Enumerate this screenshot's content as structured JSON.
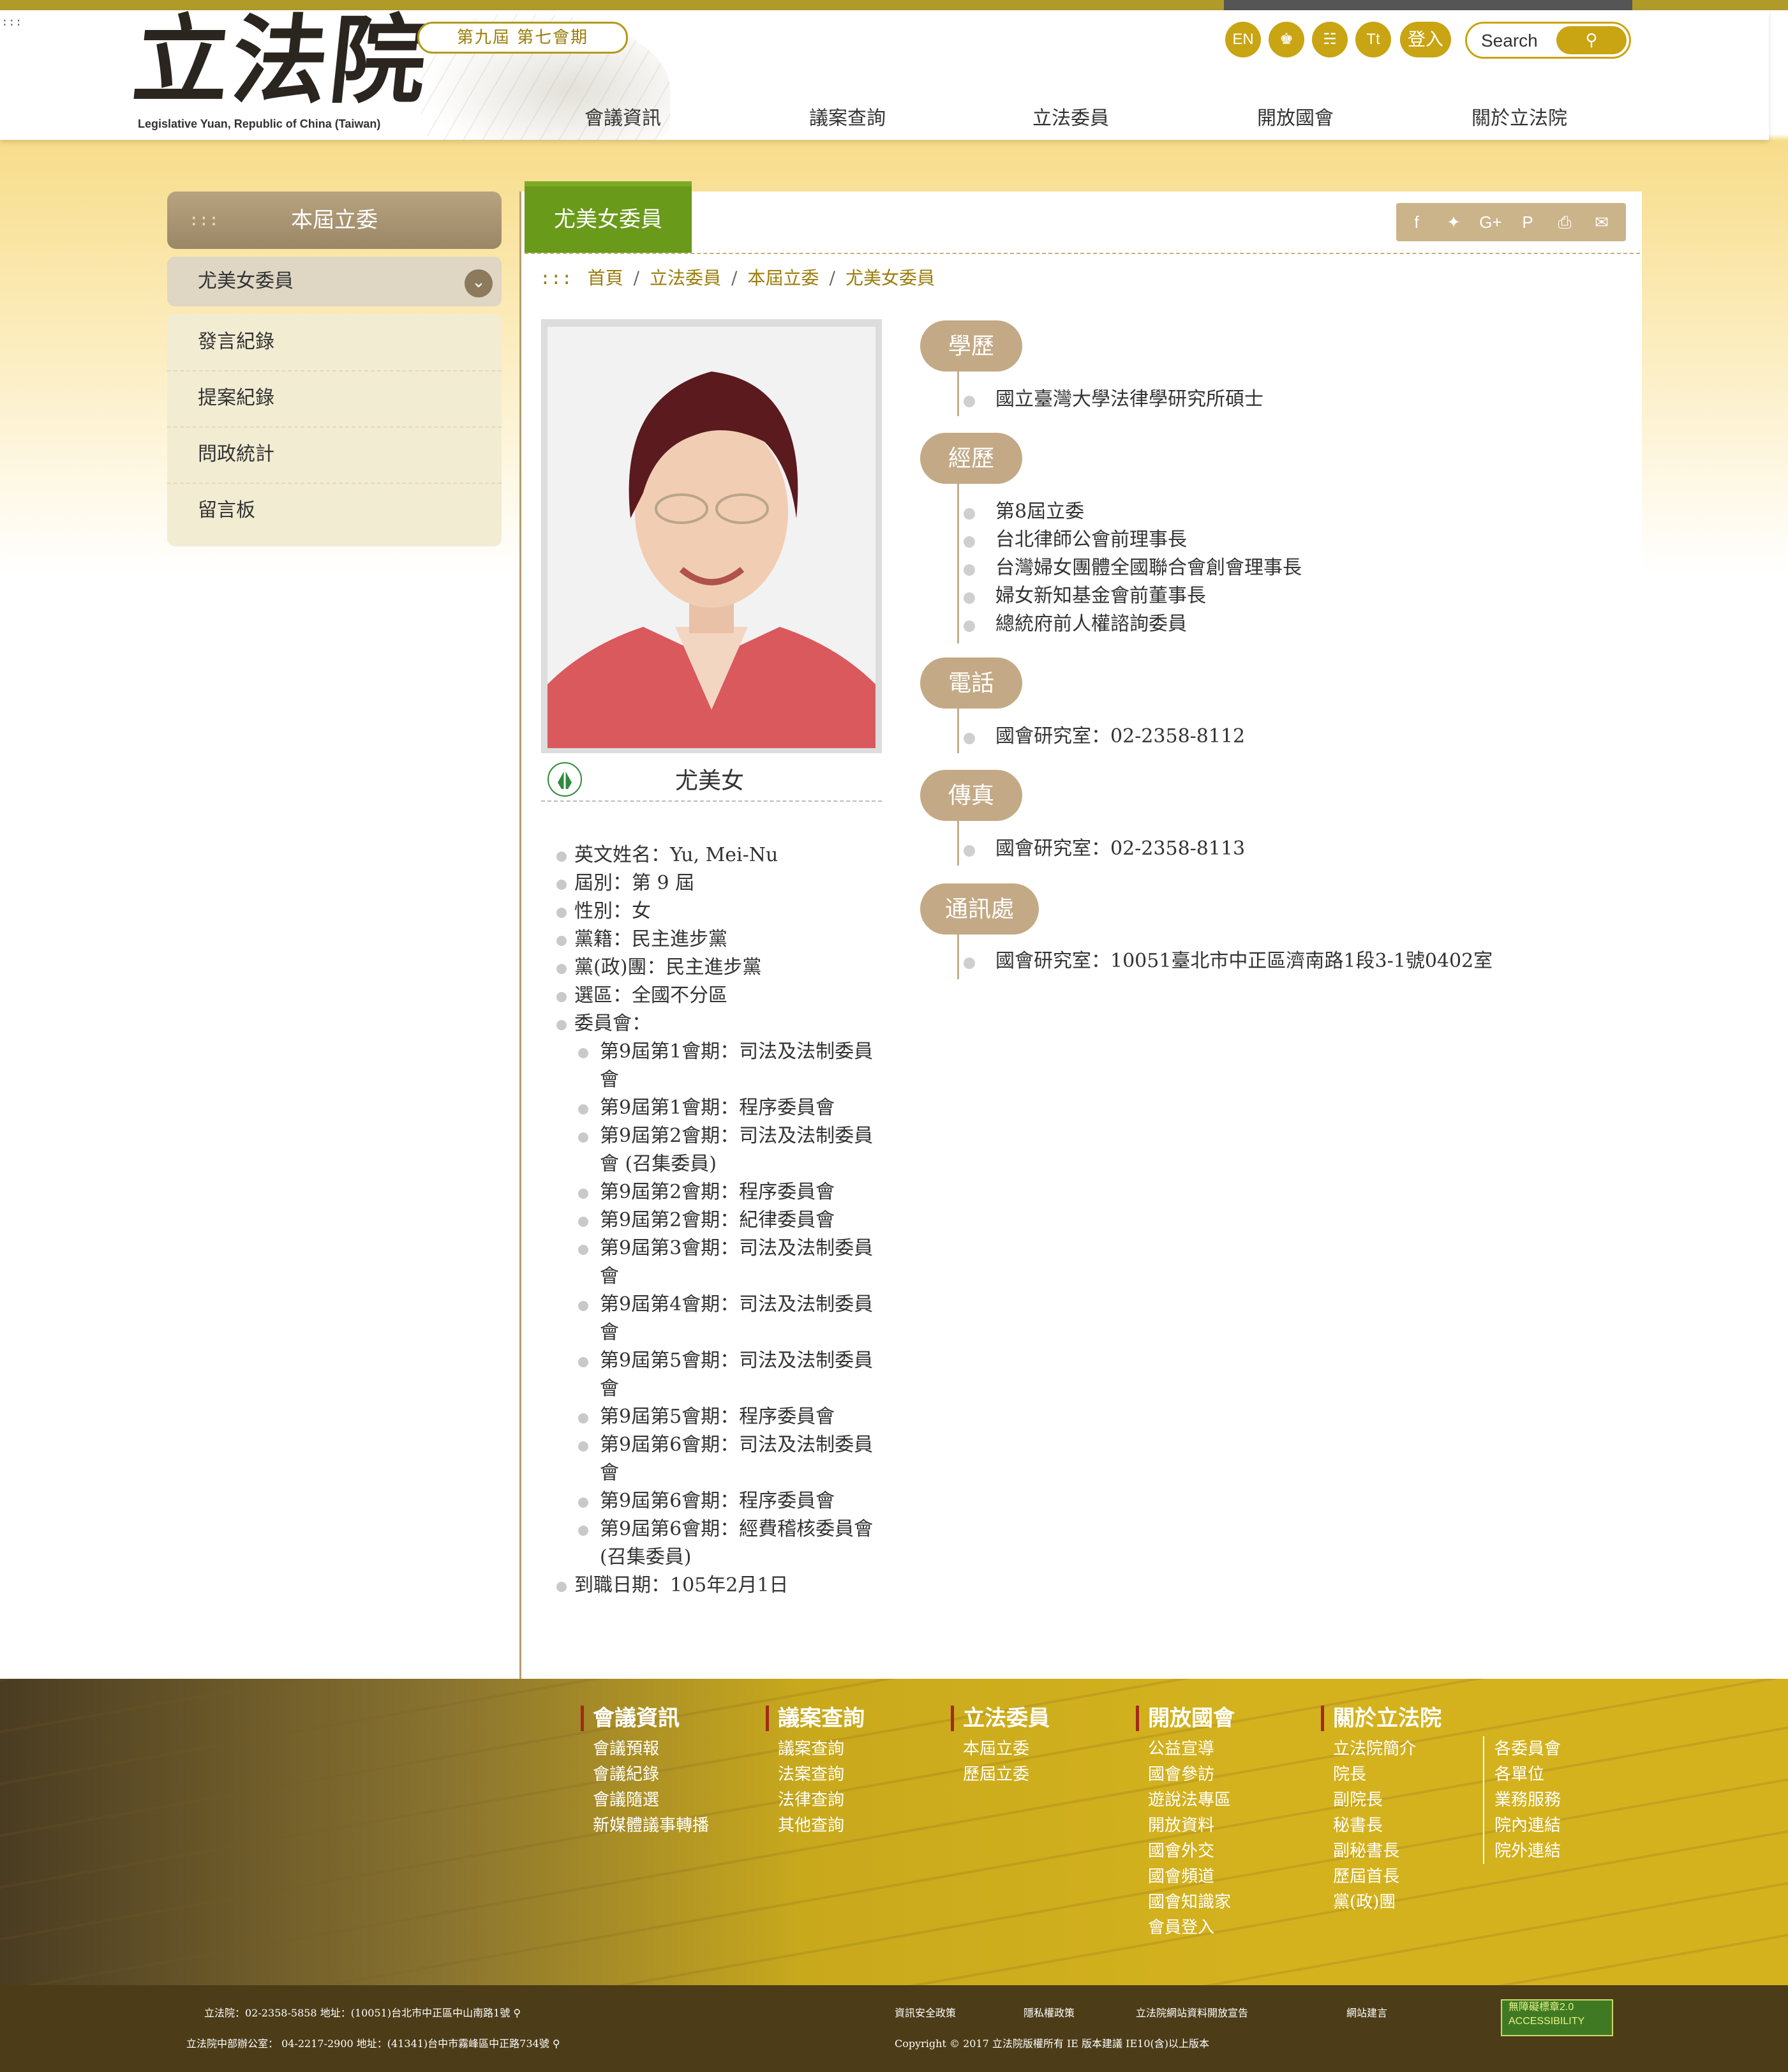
{
  "header": {
    "skip": ":::",
    "logo_cn": "立法院",
    "logo_en": "Legislative Yuan, Republic of China (Taiwan)",
    "session": "第九屆 第七會期",
    "util": {
      "en": "EN",
      "font": "Tt",
      "login": "登入"
    },
    "search_placeholder": "Search",
    "nav": [
      "會議資訊",
      "議案查詢",
      "立法委員",
      "開放國會",
      "關於立法院"
    ]
  },
  "sidebar": {
    "dots": ":::",
    "title": "本屆立委",
    "member": "尤美女委員",
    "items": [
      "發言紀錄",
      "提案紀錄",
      "問政統計",
      "留言板"
    ]
  },
  "main": {
    "tab": "尤美女委員",
    "breadcrumb": {
      "dots": ":::",
      "items": [
        "首頁",
        "立法委員",
        "本屆立委",
        "尤美女委員"
      ]
    },
    "name": "尤美女",
    "info": {
      "english_name": "英文姓名：Yu, Mei-Nu",
      "term": "屆別：第 9 屆",
      "gender": "性別：女",
      "party": "黨籍：民主進步黨",
      "caucus": "黨(政)團：民主進步黨",
      "district": "選區：全國不分區",
      "committee_label": "委員會：",
      "committees": [
        "第9屆第1會期：司法及法制委員會",
        "第9屆第1會期：程序委員會",
        "第9屆第2會期：司法及法制委員會 (召集委員)",
        "第9屆第2會期：程序委員會",
        "第9屆第2會期：紀律委員會",
        "第9屆第3會期：司法及法制委員會",
        "第9屆第4會期：司法及法制委員會",
        "第9屆第5會期：司法及法制委員會",
        "第9屆第5會期：程序委員會",
        "第9屆第6會期：司法及法制委員會",
        "第9屆第6會期：程序委員會",
        "第9屆第6會期：經費稽核委員會 (召集委員)"
      ],
      "start_date": "到職日期：105年2月1日"
    },
    "sections": {
      "education": {
        "title": "學歷",
        "items": [
          "國立臺灣大學法律學研究所碩士"
        ]
      },
      "experience": {
        "title": "經歷",
        "items": [
          "第8屆立委",
          "台北律師公會前理事長",
          "台灣婦女團體全國聯合會創會理事長",
          "婦女新知基金會前董事長",
          "總統府前人權諮詢委員"
        ]
      },
      "phone": {
        "title": "電話",
        "items": [
          "國會研究室：02-2358-8112"
        ]
      },
      "fax": {
        "title": "傳真",
        "items": [
          "國會研究室：02-2358-8113"
        ]
      },
      "address": {
        "title": "通訊處",
        "items": [
          "國會研究室：10051臺北市中正區濟南路1段3-1號0402室"
        ]
      }
    }
  },
  "footer": {
    "cols": [
      {
        "title": "會議資訊",
        "links": [
          "會議預報",
          "會議紀錄",
          "會議隨選",
          "新媒體議事轉播"
        ]
      },
      {
        "title": "議案查詢",
        "links": [
          "議案查詢",
          "法案查詢",
          "法律查詢",
          "其他查詢"
        ]
      },
      {
        "title": "立法委員",
        "links": [
          "本屆立委",
          "歷屆立委"
        ]
      },
      {
        "title": "開放國會",
        "links": [
          "公益宣導",
          "國會參訪",
          "遊說法專區",
          "開放資料",
          "國會外交",
          "國會頻道",
          "國會知識家",
          "會員登入"
        ]
      },
      {
        "title": "關於立法院",
        "links": [
          "立法院簡介",
          "院長",
          "副院長",
          "秘書長",
          "副秘書長",
          "歷屆首長",
          "黨(政)團"
        ]
      }
    ],
    "extra_links": [
      "各委員會",
      "各單位",
      "業務服務",
      "院內連結",
      "院外連結"
    ],
    "contact1": "立法院：02-2358-5858   地址：(10051)台北市中正區中山南路1號",
    "contact2": "立法院中部辦公室： 04-2217-2900   地址：(41341)台中市霧峰區中正路734號",
    "policies": [
      "資訊安全政策",
      "隱私權政策",
      "立法院網站資料開放宣告",
      "網站建言"
    ],
    "copyright": "Copyright © 2017 立法院版權所有 IE 版本建議 IE10(含)以上版本",
    "badge": "無障礙標章2.0 ACCESSIBILITY"
  }
}
